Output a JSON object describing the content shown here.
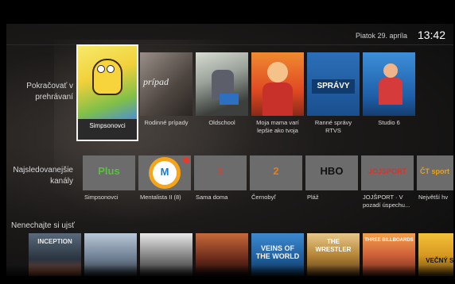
{
  "header": {
    "date": "Piatok 29. apríla",
    "time": "13:42"
  },
  "rows": {
    "continue": {
      "label": "Pokračovať v prehrávaní",
      "items": [
        {
          "title": "Simpsonovci",
          "art": "simpsons-poster"
        },
        {
          "title": "Rodinné prípady",
          "art": "rodinne-pripady-poster"
        },
        {
          "title": "Oldschool",
          "art": "oldschool-poster"
        },
        {
          "title": "Moja mama varí lepšie ako tvoja",
          "art": "cooking-show-poster"
        },
        {
          "title": "Ranné správy RTVS",
          "art": "spravy-rtvs-poster",
          "badge": "SPRÁVY"
        },
        {
          "title": "Studio 6",
          "art": "studio6-poster"
        }
      ]
    },
    "channels": {
      "label": "Najsledovanejšie kanály",
      "items": [
        {
          "logo": "Plus",
          "caption": "Simpsonovci",
          "color": "#58c23c"
        },
        {
          "logo": "M",
          "caption": "Mentalista II (8)",
          "color": "#1a7bc8",
          "live": true
        },
        {
          "logo": "1",
          "caption": "Sama doma",
          "color": "#e33b2a"
        },
        {
          "logo": "2",
          "caption": "Černobyľ",
          "color": "#e47f1c"
        },
        {
          "logo": "HBO",
          "caption": "Pláž",
          "color": "#111111"
        },
        {
          "logo": "JOJSPORT",
          "caption": "JOJŠPORT · V pozadí úspechu...",
          "color": "#d9342b"
        },
        {
          "logo": "ČT sport",
          "caption": "Největší hv",
          "color": "#e6a21b"
        }
      ]
    },
    "movies": {
      "label": "Nenechajte si ujsť",
      "items": [
        {
          "title": "INCEPTION",
          "art": "inception-poster"
        },
        {
          "title": "",
          "art": "movie-poster-2"
        },
        {
          "title": "",
          "art": "movie-poster-3"
        },
        {
          "title": "",
          "art": "movie-poster-4"
        },
        {
          "title": "VEINS OF THE WORLD",
          "art": "veins-poster"
        },
        {
          "title": "THE WRESTLER",
          "art": "wrestler-poster"
        },
        {
          "title": "THREE BILLBOARDS",
          "art": "three-billboards-poster"
        },
        {
          "title": "VEČNÝ SVIT",
          "art": "vecny-svit-poster"
        }
      ]
    }
  }
}
